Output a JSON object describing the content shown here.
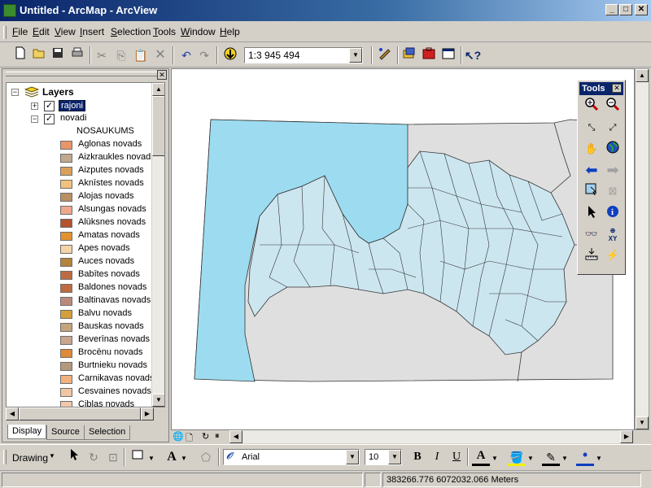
{
  "window": {
    "title": "Untitled - ArcMap - ArcView",
    "minimize": "_",
    "maximize": "□",
    "close": "✕"
  },
  "menu": [
    "File",
    "Edit",
    "View",
    "Insert",
    "Selection",
    "Tools",
    "Window",
    "Help"
  ],
  "toolbar": {
    "scale": "1:3 945 494",
    "icons": [
      "new-icon",
      "open-icon",
      "save-icon",
      "print-icon",
      "cut-icon",
      "copy-icon",
      "paste-icon",
      "delete-icon",
      "undo-icon",
      "redo-icon",
      "add-data-icon",
      "editor-icon",
      "arccatalog-icon",
      "arctoolbox-icon",
      "command-line-icon",
      "whats-this-icon"
    ]
  },
  "toc": {
    "root_label": "Layers",
    "layers": [
      {
        "name": "rajoni",
        "checked": true,
        "expanded": false,
        "selected": true
      },
      {
        "name": "novadi",
        "checked": true,
        "expanded": true,
        "selected": false
      }
    ],
    "field_header": "NOSAUKUMS",
    "legend": [
      {
        "label": "Aglonas novads",
        "color": "#e9956a"
      },
      {
        "label": "Aizkraukles novads",
        "color": "#c0a98e"
      },
      {
        "label": "Aizputes novads",
        "color": "#dba058"
      },
      {
        "label": "Aknīstes novads",
        "color": "#f0c27c"
      },
      {
        "label": "Alojas novads",
        "color": "#b99061"
      },
      {
        "label": "Alsungas novads",
        "color": "#efa98a"
      },
      {
        "label": "Alūksnes novads",
        "color": "#b4522e"
      },
      {
        "label": "Amatas novads",
        "color": "#e39230"
      },
      {
        "label": "Apes novads",
        "color": "#f6d3a7"
      },
      {
        "label": "Auces novads",
        "color": "#b5833c"
      },
      {
        "label": "Babītes novads",
        "color": "#c06a43"
      },
      {
        "label": "Baldones novads",
        "color": "#c06a43"
      },
      {
        "label": "Baltinavas novads",
        "color": "#bb8a7c"
      },
      {
        "label": "Balvu novads",
        "color": "#d59f39"
      },
      {
        "label": "Bauskas novads",
        "color": "#c5a67a"
      },
      {
        "label": "Beverīnas novads",
        "color": "#c8a58c"
      },
      {
        "label": "Brocēnu novads",
        "color": "#de8a37"
      },
      {
        "label": "Burtnieku novads",
        "color": "#b39a7d"
      },
      {
        "label": "Carnikavas novads",
        "color": "#f1b27f"
      },
      {
        "label": "Cesvaines novads",
        "color": "#f0c6a3"
      },
      {
        "label": "Ciblas novads",
        "color": "#f3c7a9"
      }
    ],
    "tabs": [
      "Display",
      "Source",
      "Selection"
    ]
  },
  "tools_palette": {
    "title": "Tools",
    "close": "✕"
  },
  "drawing": {
    "label": "Drawing",
    "font": "Arial",
    "size": "10",
    "bold": "B",
    "italic": "I",
    "underline": "U",
    "text_a": "A"
  },
  "status": {
    "coordinates": "383266.776  6072032.066 Meters"
  },
  "colors": {
    "sea": "#9ddcf0",
    "land_lv": "#cce6f0",
    "land_other": "#e0dfdf",
    "title_start": "#0a246a",
    "title_end": "#a6caf0"
  }
}
